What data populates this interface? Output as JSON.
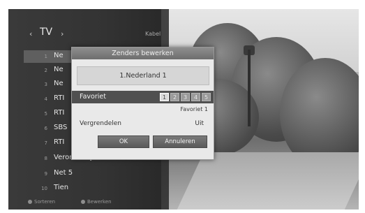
{
  "header": {
    "title": "TV",
    "source": "Kabel"
  },
  "channels": [
    {
      "num": "1",
      "name": "Ne"
    },
    {
      "num": "2",
      "name": "Ne"
    },
    {
      "num": "3",
      "name": "Ne"
    },
    {
      "num": "4",
      "name": "RTI"
    },
    {
      "num": "5",
      "name": "RTI"
    },
    {
      "num": "6",
      "name": "SBS"
    },
    {
      "num": "7",
      "name": "RTI"
    },
    {
      "num": "8",
      "name": "Veronica / Jetix"
    },
    {
      "num": "9",
      "name": "Net 5"
    },
    {
      "num": "10",
      "name": "Tien"
    }
  ],
  "footer": {
    "sort_label": "Sorteren",
    "edit_label": "Bewerken"
  },
  "dialog": {
    "title": "Zenders bewerken",
    "channel_name": "1.Nederland 1",
    "favorite_label": "Favoriet",
    "favorite_boxes": [
      "1",
      "2",
      "3",
      "4",
      "5"
    ],
    "favorite_selected": "1",
    "favorite_value": "Favoriet 1",
    "lock_label": "Vergrendelen",
    "lock_value": "Uit",
    "ok_label": "OK",
    "cancel_label": "Annuleren"
  }
}
